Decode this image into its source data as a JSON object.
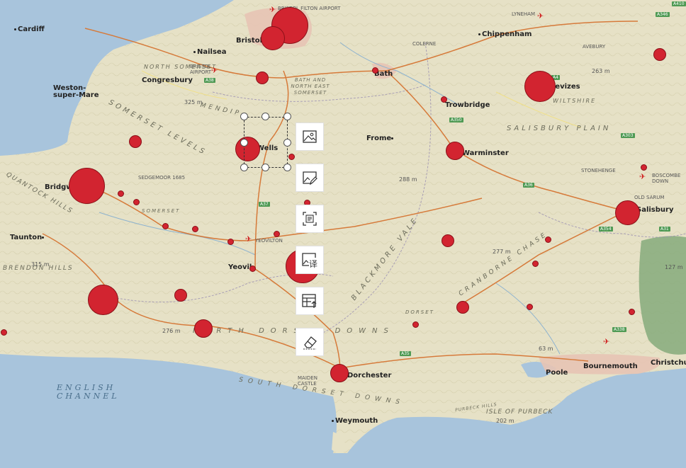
{
  "map": {
    "places": [
      {
        "id": "cardiff",
        "name": "Cardiff"
      },
      {
        "id": "bristol",
        "name": "Bristol"
      },
      {
        "id": "chippenham",
        "name": "Chippenham"
      },
      {
        "id": "nailsea",
        "name": "Nailsea"
      },
      {
        "id": "congresbury",
        "name": "Congresbury"
      },
      {
        "id": "weston",
        "name": "Weston-super-Mare"
      },
      {
        "id": "bath",
        "name": "Bath"
      },
      {
        "id": "trowbridge",
        "name": "Trowbridge"
      },
      {
        "id": "devizes",
        "name": "Devizes"
      },
      {
        "id": "frome",
        "name": "Frome"
      },
      {
        "id": "warminster",
        "name": "Warminster"
      },
      {
        "id": "wells",
        "name": "Wells"
      },
      {
        "id": "bridgwater",
        "name": "Bridgwater"
      },
      {
        "id": "taunton",
        "name": "Taunton"
      },
      {
        "id": "yeovil",
        "name": "Yeovil"
      },
      {
        "id": "salisbury",
        "name": "Salisbury"
      },
      {
        "id": "dorchester",
        "name": "Dorchester"
      },
      {
        "id": "weymouth",
        "name": "Weymouth"
      },
      {
        "id": "poole",
        "name": "Poole"
      },
      {
        "id": "bournemouth",
        "name": "Bournemouth"
      },
      {
        "id": "christchurch",
        "name": "Christchurch"
      }
    ],
    "regions": [
      {
        "id": "north-somerset",
        "text": "NORTH SOMERSET"
      },
      {
        "id": "bath-ne-somerset",
        "text": "BATH AND NORTH EAST SOMERSET"
      },
      {
        "id": "mendip",
        "text": "MENDIP"
      },
      {
        "id": "somerset-levels",
        "text": "SOMERSET LEVELS"
      },
      {
        "id": "wiltshire",
        "text": "WILTSHIRE"
      },
      {
        "id": "salisbury-plain",
        "text": "SALISBURY PLAIN"
      },
      {
        "id": "blackmore-vale",
        "text": "BLACKMORE VALE"
      },
      {
        "id": "cranborne-chase",
        "text": "CRANBORNE CHASE"
      },
      {
        "id": "north-dorset-downs",
        "text": "NORTH DORSET DOWNS"
      },
      {
        "id": "south-dorset-downs",
        "text": "SOUTH DORSET DOWNS"
      },
      {
        "id": "english-channel",
        "text": "ENGLISH CHANNEL"
      },
      {
        "id": "isle-of-purbeck",
        "text": "ISLE OF PURBECK"
      },
      {
        "id": "purbeck-hills",
        "text": "PURBECK HILLS"
      },
      {
        "id": "quantock-hills",
        "text": "QUANTOCK HILLS"
      },
      {
        "id": "brendon-hills",
        "text": "BRENDON HILLS"
      },
      {
        "id": "somerset",
        "text": "SOMERSET"
      },
      {
        "id": "dorset",
        "text": "DORSET"
      }
    ],
    "small_labels": [
      {
        "id": "bristol-airport",
        "text": "BRISTOL FILTON AIRPORT"
      },
      {
        "id": "lyneham",
        "text": "LYNEHAM"
      },
      {
        "id": "colerne",
        "text": "COLERNE"
      },
      {
        "id": "avebury",
        "text": "AVEBURY"
      },
      {
        "id": "bristol-lulsgate",
        "text": "BRISTOL AIRPORT"
      },
      {
        "id": "sedgemoor",
        "text": "SEDGEMOOR 1685"
      },
      {
        "id": "yeovilton",
        "text": "YEOVILTON"
      },
      {
        "id": "stonehenge",
        "text": "STONEHENGE"
      },
      {
        "id": "boscombe",
        "text": "BOSCOMBE DOWN"
      },
      {
        "id": "old-sarum",
        "text": "OLD SARUM"
      },
      {
        "id": "maiden-castle",
        "text": "MAIDEN CASTLE"
      }
    ],
    "elevations": [
      {
        "id": "e-325",
        "text": "325 m"
      },
      {
        "id": "e-288",
        "text": "288 m"
      },
      {
        "id": "e-277",
        "text": "277 m"
      },
      {
        "id": "e-276",
        "text": "276 m"
      },
      {
        "id": "e-315",
        "text": "315 m"
      },
      {
        "id": "e-263",
        "text": "263 m"
      },
      {
        "id": "e-202",
        "text": "202 m"
      },
      {
        "id": "e-63",
        "text": "63 m"
      },
      {
        "id": "e-127",
        "text": "127 m"
      }
    ],
    "roads": [
      {
        "id": "a38",
        "text": "A38"
      },
      {
        "id": "a346",
        "text": "A346"
      },
      {
        "id": "a4",
        "text": "A4"
      },
      {
        "id": "a350",
        "text": "A350"
      },
      {
        "id": "a36",
        "text": "A36"
      },
      {
        "id": "a303",
        "text": "A303"
      },
      {
        "id": "a37",
        "text": "A37"
      },
      {
        "id": "a354",
        "text": "A354"
      },
      {
        "id": "a31",
        "text": "A31"
      },
      {
        "id": "a35",
        "text": "A35"
      },
      {
        "id": "a338",
        "text": "A338"
      },
      {
        "id": "a410",
        "text": "A410"
      }
    ],
    "markers": [
      {
        "id": "bristol-large",
        "size": "large"
      },
      {
        "id": "bristol-medium",
        "size": "medium"
      },
      {
        "id": "devizes",
        "size": "medium"
      },
      {
        "id": "bridgwater",
        "size": "large"
      },
      {
        "id": "wells",
        "size": "medium"
      },
      {
        "id": "salisbury",
        "size": "medium"
      },
      {
        "id": "yeovil-area",
        "size": "large"
      },
      {
        "id": "taunton-south",
        "size": "large"
      },
      {
        "id": "warminster",
        "size": "small"
      },
      {
        "id": "dorchester",
        "size": "small"
      },
      {
        "id": "north-dorset",
        "size": "small"
      }
    ]
  },
  "toolbar": {
    "items": [
      {
        "id": "insert-image",
        "icon": "image-icon"
      },
      {
        "id": "edit-image",
        "icon": "image-edit-icon"
      },
      {
        "id": "extract-text",
        "icon": "text-extract-icon"
      },
      {
        "id": "translate-image",
        "icon": "image-translate-icon",
        "glyph": "译"
      },
      {
        "id": "table-export",
        "icon": "table-export-icon"
      },
      {
        "id": "erase",
        "icon": "eraser-icon"
      }
    ]
  },
  "selection": {
    "active": true
  },
  "colors": {
    "sea": "#a8c4dc",
    "land": "#e6e1c6",
    "marker": "#d22430",
    "road_green": "#4f9a54",
    "forest": "#7fa877"
  }
}
